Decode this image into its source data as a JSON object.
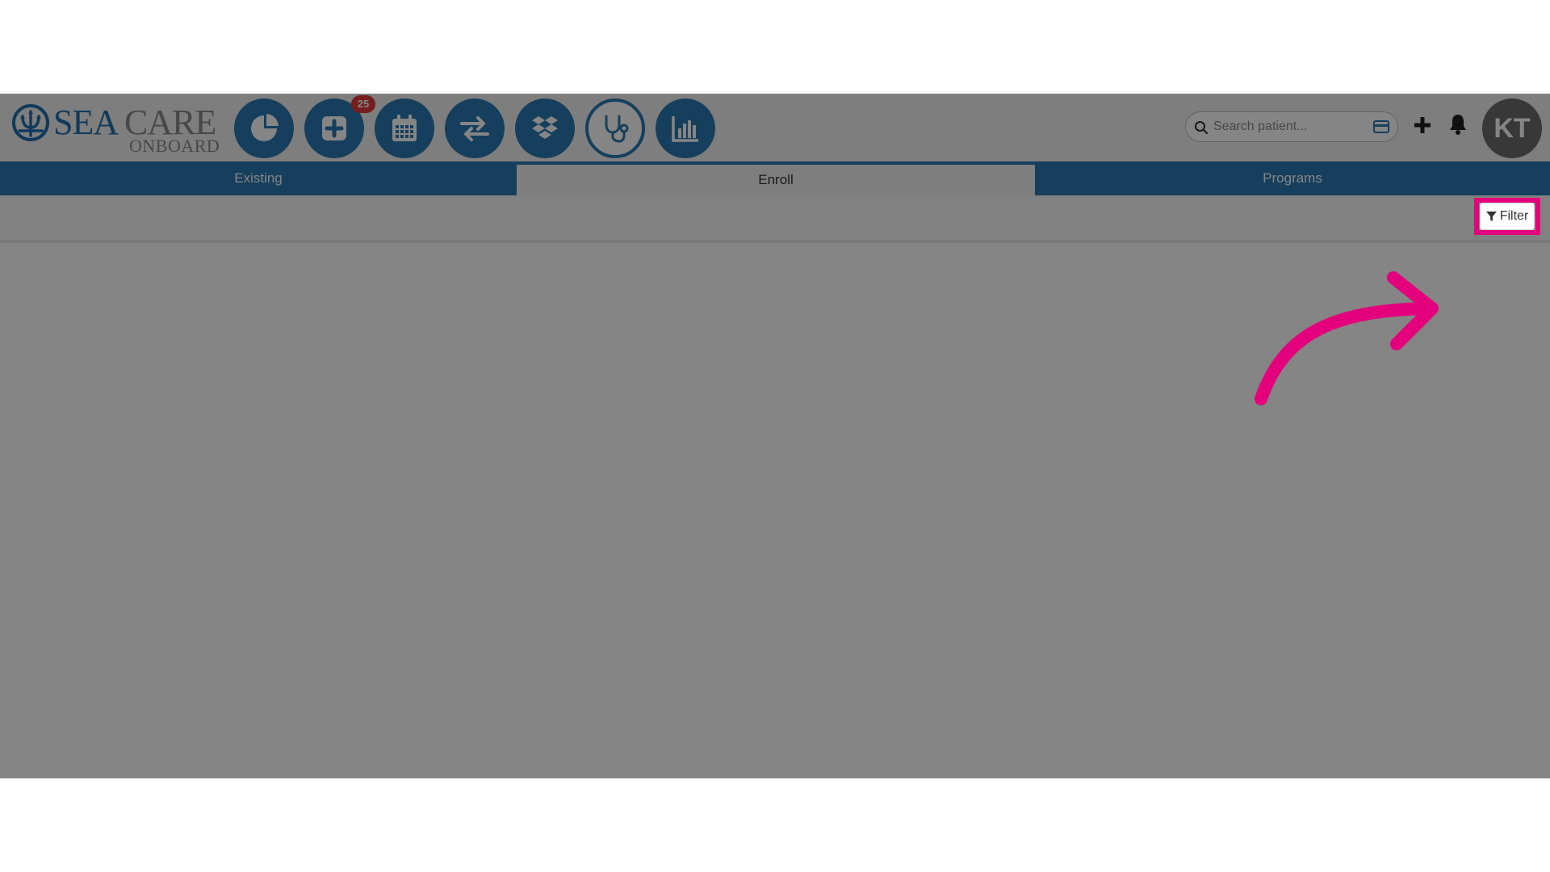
{
  "app": {
    "logo_text_sea": "SEA",
    "logo_text_care": "CARE",
    "logo_text_onboard": "ONBOARD"
  },
  "nav": {
    "buttons": [
      {
        "icon": "pie-chart-icon"
      },
      {
        "icon": "medical-plus-icon",
        "badge": "25"
      },
      {
        "icon": "calendar-icon"
      },
      {
        "icon": "exchange-arrows-icon"
      },
      {
        "icon": "dropbox-icon"
      },
      {
        "icon": "stethoscope-icon"
      },
      {
        "icon": "bar-chart-icon"
      }
    ],
    "accent_color": "#2a79b3",
    "badge_color": "#e03a3a"
  },
  "search": {
    "placeholder": "Search patient..."
  },
  "user": {
    "initials": "KT"
  },
  "tabs": [
    {
      "label": "Existing",
      "active": false
    },
    {
      "label": "Enroll",
      "active": true
    },
    {
      "label": "Programs",
      "active": false
    }
  ],
  "toolbar": {
    "filter_label": "Filter"
  },
  "annotation": {
    "highlight_color": "#e4007c"
  }
}
